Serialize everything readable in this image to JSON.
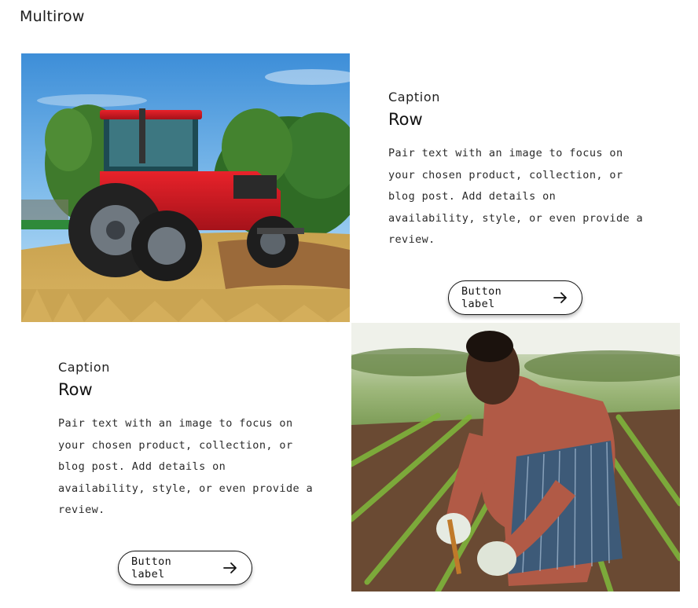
{
  "section": {
    "title": "Multirow"
  },
  "rows": [
    {
      "image_icon": "tractor-photo",
      "caption": "Caption",
      "heading": "Row",
      "text": "Pair text with an image to focus on your chosen product, collection, or blog post. Add details on availability, style, or even provide a review.",
      "button_label": "Button label",
      "button_icon": "arrow-right-icon"
    },
    {
      "image_icon": "farmer-photo",
      "caption": "Caption",
      "heading": "Row",
      "text": "Pair text with an image to focus on your chosen product, collection, or blog post. Add details on availability, style, or even provide a review.",
      "button_label": "Button label",
      "button_icon": "arrow-right-icon"
    }
  ],
  "colors": {
    "text": "#121212",
    "button_border": "#121212",
    "background": "#ffffff"
  }
}
